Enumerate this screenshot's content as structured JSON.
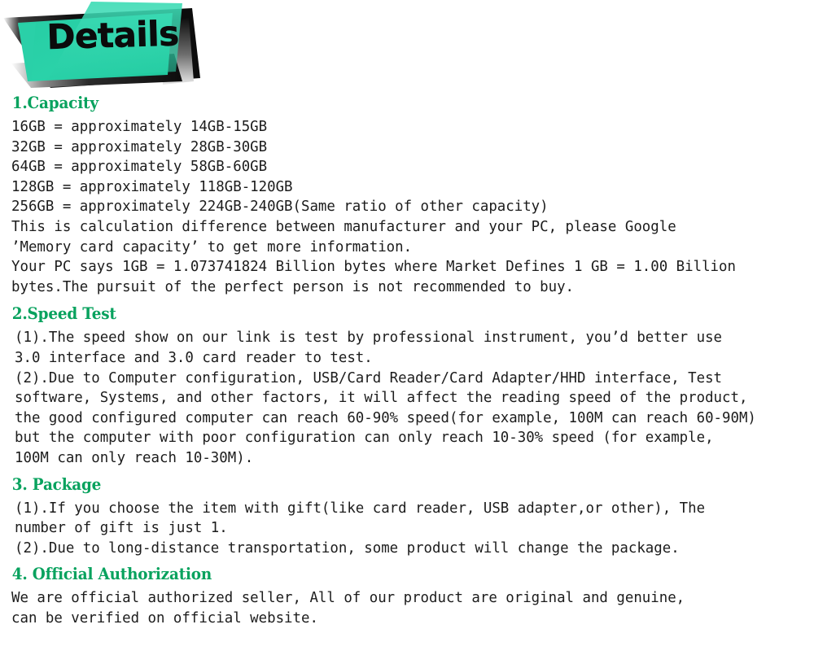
{
  "banner": {
    "title": "Details",
    "teal": "#2ad0a8",
    "teal_light": "#3fdcb6",
    "dark": "#151515"
  },
  "theme": {
    "heading_color": "#08a25e",
    "body_color": "#1c1c1c",
    "background": "#ffffff"
  },
  "sections": [
    {
      "heading": "1.Capacity",
      "paragraphs": [
        "16GB = approximately 14GB-15GB\n32GB = approximately 28GB-30GB\n64GB = approximately 58GB-60GB\n128GB = approximately 118GB-120GB\n256GB = approximately 224GB-240GB(Same ratio of other capacity)\nThis is calculation difference between manufacturer and your PC, please Google\n’Memory card capacity’ to get more information.\nYour PC says 1GB = 1.073741824 Billion bytes where Market Defines 1 GB = 1.00 Billion\nbytes.The pursuit of the perfect person is not recommended to buy."
      ]
    },
    {
      "heading": "2.Speed Test",
      "paragraphs": [
        "(1).The speed show on our link is test by professional instrument, you’d better use\n3.0 interface and 3.0 card reader to test.\n(2).Due to Computer configuration, USB/Card Reader/Card Adapter/HHD interface, Test\nsoftware, Systems, and other factors, it will affect the reading speed of the product,\nthe good configured computer can reach 60-90% speed(for example, 100M can reach 60-90M)\nbut the computer with poor configuration can only reach 10-30% speed (for example,\n100M can only reach 10-30M)."
      ]
    },
    {
      "heading": "3. Package",
      "paragraphs": [
        "(1).If you choose the item with gift(like card reader, USB adapter,or other), The\nnumber of gift is just 1.\n(2).Due to long-distance transportation, some product will change the package."
      ]
    },
    {
      "heading": "4. Official Authorization",
      "paragraphs": [
        "We are official authorized seller, All of our product are original and genuine,\ncan be verified on official website."
      ]
    }
  ]
}
